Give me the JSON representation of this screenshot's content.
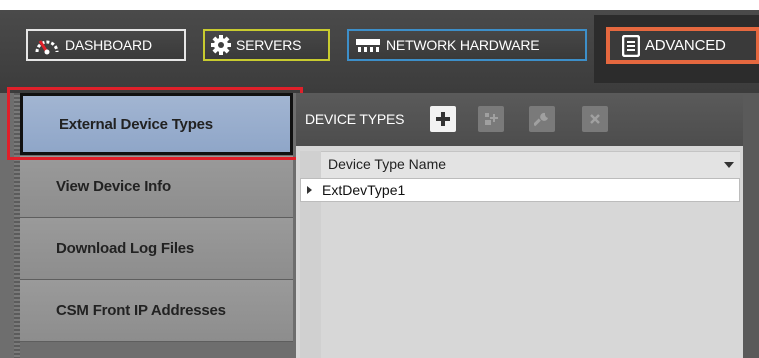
{
  "nav": {
    "dashboard": {
      "label": "DASHBOARD",
      "icon": "dashboard-gauge-icon",
      "border": "#e6e6e6"
    },
    "servers": {
      "label": "SERVERS",
      "icon": "gear-icon",
      "border": "#c8cb2f"
    },
    "network": {
      "label": "NETWORK HARDWARE",
      "icon": "network-switch-icon",
      "border": "#3d8fc9"
    },
    "advanced": {
      "label": "ADVANCED",
      "icon": "document-list-icon",
      "border": "#e5683f"
    }
  },
  "sidebar": {
    "items": [
      {
        "label": "External Device Types",
        "active": true
      },
      {
        "label": "View Device Info",
        "active": false
      },
      {
        "label": "Download Log Files",
        "active": false
      },
      {
        "label": "CSM Front IP Addresses",
        "active": false
      }
    ]
  },
  "panel": {
    "title": "DEVICE TYPES",
    "toolbar_icons": [
      "add-icon",
      "add-item-icon",
      "wrench-icon",
      "close-icon"
    ],
    "column_header": "Device Type Name",
    "rows": [
      {
        "name": "ExtDevType1"
      }
    ]
  },
  "colors": {
    "highlight": "#e0202a",
    "active_item": "#9aafcf"
  }
}
